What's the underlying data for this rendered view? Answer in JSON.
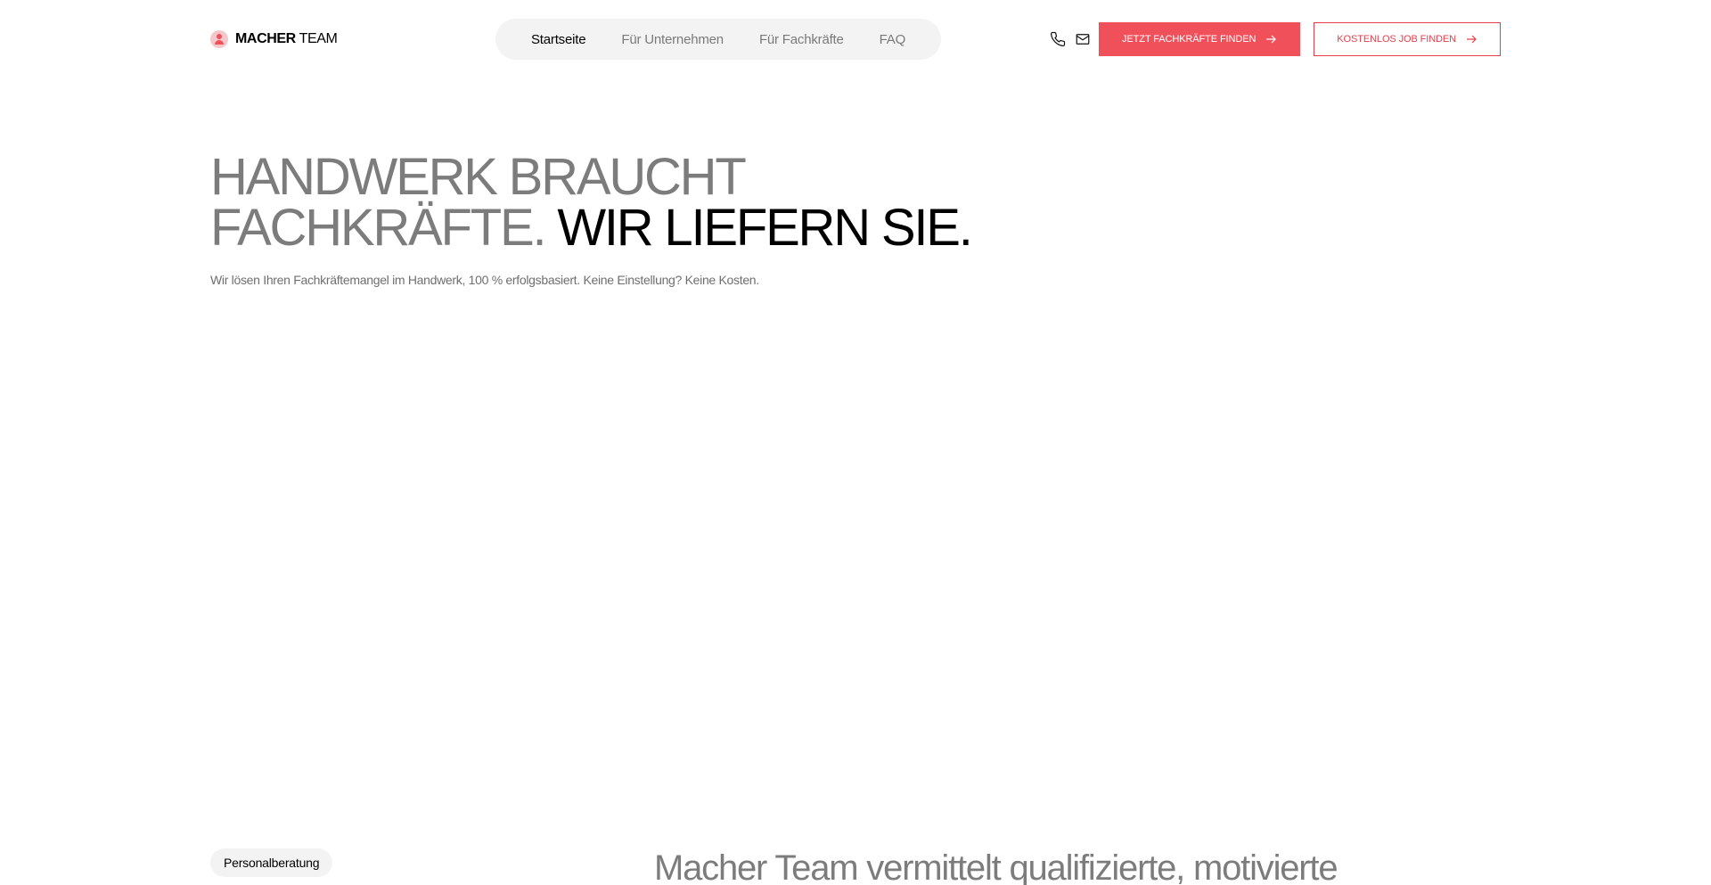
{
  "brand": {
    "logo_bold": "MACHER",
    "logo_light": " TEAM",
    "accent_color": "#f0505a"
  },
  "nav": {
    "items": [
      {
        "label": "Startseite",
        "active": true
      },
      {
        "label": "Für Unternehmen",
        "active": false
      },
      {
        "label": "Für Fachkräfte",
        "active": false
      },
      {
        "label": "FAQ",
        "active": false
      }
    ]
  },
  "header": {
    "phone_icon": "phone-icon",
    "mail_icon": "mail-icon",
    "cta_primary": "JETZT FACHKRÄFTE FINDEN",
    "cta_secondary": "KOSTENLOS JOB FINDEN"
  },
  "hero": {
    "title_line1": "HANDWERK BRAUCHT",
    "title_line2_light": "FACHKRÄFTE.",
    "title_line2_dark": "WIR LIEFERN SIE.",
    "subtitle": "Wir lösen Ihren Fachkräftemangel im Handwerk, 100 % erfolgsbasiert. Keine Einstellung? Keine Kosten."
  },
  "section": {
    "tag": "Personalberatung",
    "intro": "Macher Team vermittelt qualifizierte, motivierte"
  }
}
